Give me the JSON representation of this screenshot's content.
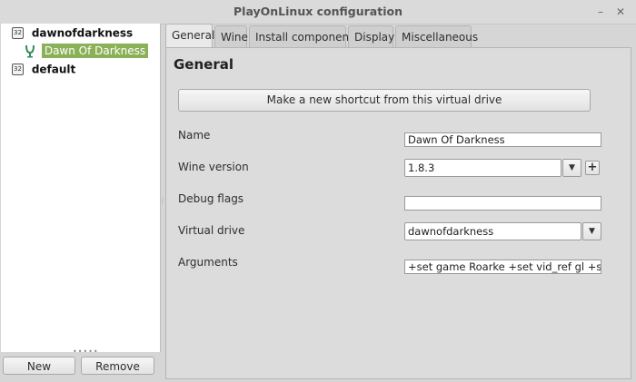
{
  "window": {
    "title": "PlayOnLinux configuration"
  },
  "titlebar": {
    "minimize_glyph": "–",
    "close_glyph": "✕"
  },
  "tree": {
    "items": [
      {
        "badge": "32",
        "label": "dawnofdarkness",
        "children": [
          {
            "label": "Dawn Of Darkness",
            "selected": true
          }
        ]
      },
      {
        "badge": "32",
        "label": "default",
        "children": []
      }
    ],
    "splitter_glyph": "•••••",
    "vsplitter_glyph": "⋮"
  },
  "buttons": {
    "new": "New",
    "remove": "Remove"
  },
  "tabs": [
    {
      "label": "General",
      "active": true
    },
    {
      "label": "Wine"
    },
    {
      "label": "Install components"
    },
    {
      "label": "Display"
    },
    {
      "label": "Miscellaneous"
    }
  ],
  "general": {
    "heading": "General",
    "shortcut_button": "Make a new shortcut from this virtual drive",
    "name": {
      "label": "Name",
      "value": "Dawn Of Darkness"
    },
    "wine_version": {
      "label": "Wine version",
      "value": "1.8.3",
      "plus_glyph": "+"
    },
    "debug_flags": {
      "label": "Debug flags",
      "value": ""
    },
    "virtual_drive": {
      "label": "Virtual drive",
      "value": "dawnofdarkness"
    },
    "arguments": {
      "label": "Arguments",
      "value": "+set game Roarke +set vid_ref gl +set gl_driv"
    },
    "dropdown_glyph": "▼"
  },
  "colors": {
    "selection": "#8bb158",
    "icon_accent": "#2e8b57"
  },
  "icons": {
    "badge": "32bit-badge-icon",
    "app": "dawnofdarkness-app-icon"
  }
}
